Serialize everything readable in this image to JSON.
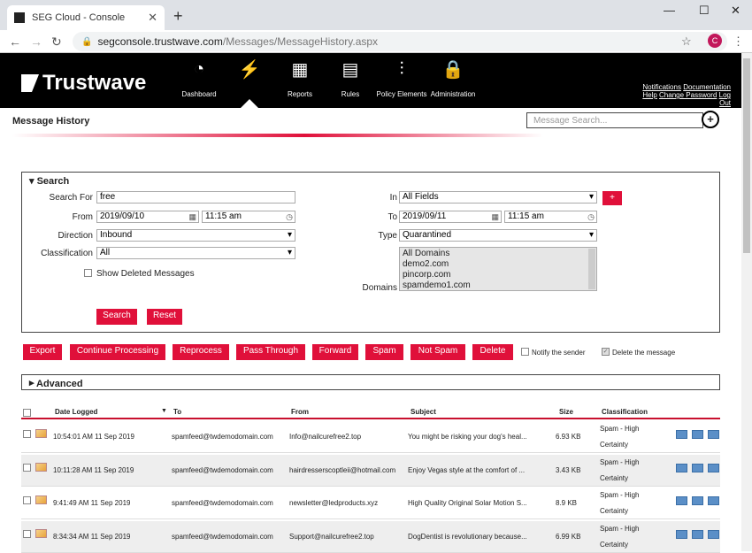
{
  "browser": {
    "tab_title": "SEG Cloud - Console",
    "tab_close": "✕",
    "new_tab": "+",
    "url_domain": "segconsole.trustwave.com",
    "url_path": "/Messages/MessageHistory.aspx",
    "avatar": "C",
    "minimize": "—",
    "maximize": "☐",
    "close": "✕",
    "back": "←",
    "forward": "→",
    "reload": "↻",
    "star": "☆",
    "menu": "⋮"
  },
  "brand": {
    "logo_text": "Trustwave"
  },
  "nav": {
    "items": [
      {
        "label": "Dashboard",
        "icon": "gauge-icon",
        "glyph": "◔"
      },
      {
        "label": "",
        "icon": "lightning-icon",
        "glyph": "⚡"
      },
      {
        "label": "Reports",
        "icon": "report-icon",
        "glyph": "▦"
      },
      {
        "label": "Rules",
        "icon": "rules-icon",
        "glyph": "▤"
      },
      {
        "label": "Policy Elements",
        "icon": "sliders-icon",
        "glyph": "⫶"
      },
      {
        "label": "Administration",
        "icon": "lock-icon",
        "glyph": "🔒"
      }
    ]
  },
  "toplinks": {
    "notifications": "Notifications",
    "documentation": "Documentation",
    "help": "Help",
    "change_password": "Change Password",
    "log": "Log",
    "out": "Out"
  },
  "page": {
    "title": "Message History",
    "search_placeholder": "Message Search..."
  },
  "search": {
    "header": "Search",
    "search_for_label": "Search For",
    "search_for_value": "free",
    "from_label": "From",
    "from_date": "2019/09/10",
    "from_time": "11:15 am",
    "direction_label": "Direction",
    "direction_value": "Inbound",
    "classification_label": "Classification",
    "classification_value": "All",
    "show_deleted_label": "Show Deleted Messages",
    "in_label": "In",
    "in_value": "All Fields",
    "to_label": "To",
    "to_date": "2019/09/11",
    "to_time": "11:15 am",
    "type_label": "Type",
    "type_value": "Quarantined",
    "domains_label": "Domains",
    "domains": [
      "All Domains",
      "demo2.com",
      "pincorp.com",
      "spamdemo1.com"
    ],
    "plus": "+",
    "search_btn": "Search",
    "reset_btn": "Reset"
  },
  "actions": {
    "buttons": [
      "Export",
      "Continue Processing",
      "Reprocess",
      "Pass Through",
      "Forward",
      "Spam",
      "Not Spam",
      "Delete"
    ],
    "notify_sender": "Notify the sender",
    "delete_message": "Delete the message"
  },
  "advanced": {
    "label": "Advanced"
  },
  "table": {
    "columns": {
      "date": "Date Logged",
      "to": "To",
      "from": "From",
      "subject": "Subject",
      "size": "Size",
      "classification": "Classification"
    },
    "rows": [
      {
        "date": "10:54:01 AM 11 Sep 2019",
        "to": "spamfeed@twdemodomain.com",
        "from": "Info@nailcurefree2.top",
        "subject": "You might be risking your dog's heal...",
        "size": "6.93 KB",
        "class1": "Spam - High",
        "class2": "Certainty"
      },
      {
        "date": "10:11:28 AM 11 Sep 2019",
        "to": "spamfeed@twdemodomain.com",
        "from": "hairdresserscoptleii@hotmail.com",
        "subject": "Enjoy Vegas style at the comfort of ...",
        "size": "3.43 KB",
        "class1": "Spam - High",
        "class2": "Certainty"
      },
      {
        "date": "9:41:49 AM 11 Sep 2019",
        "to": "spamfeed@twdemodomain.com",
        "from": "newsletter@ledproducts.xyz",
        "subject": "High Quality Original Solar Motion S...",
        "size": "8.9 KB",
        "class1": "Spam - High",
        "class2": "Certainty"
      },
      {
        "date": "8:34:34 AM 11 Sep 2019",
        "to": "spamfeed@twdemodomain.com",
        "from": "Support@nailcurefree2.top",
        "subject": "DogDentist is revolutionary because...",
        "size": "6.99 KB",
        "class1": "Spam - High",
        "class2": "Certainty"
      }
    ]
  }
}
